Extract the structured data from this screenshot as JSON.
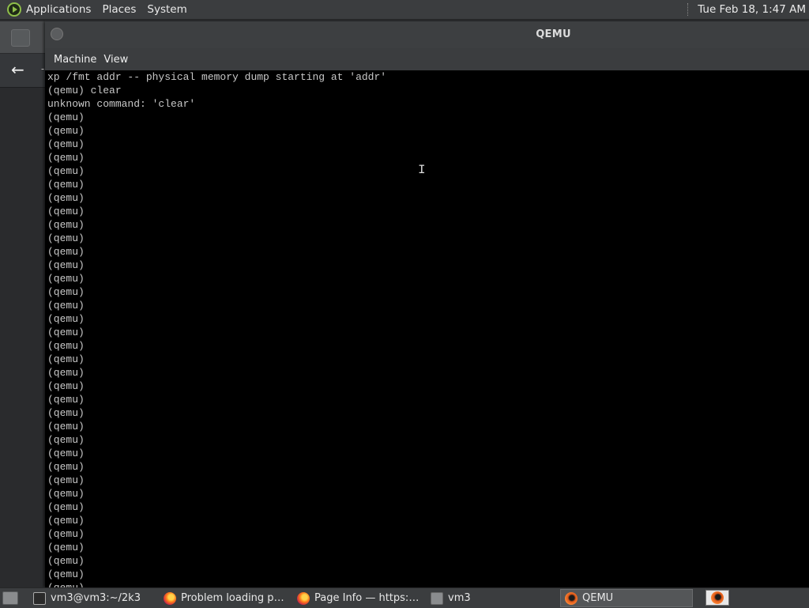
{
  "top_panel": {
    "menus": [
      "Applications",
      "Places",
      "System"
    ],
    "clock": "Tue Feb 18,  1:47 AM",
    "logo_icon": "mate-menu-icon"
  },
  "background_window": {
    "nav_icon": "back-arrow-icon",
    "back_glyph": "←",
    "dash": "-"
  },
  "qemu": {
    "title": "QEMU",
    "menus": [
      "Machine",
      "View"
    ],
    "console_lines": [
      "xp /fmt addr -- physical memory dump starting at 'addr'",
      "(qemu) clear",
      "unknown command: 'clear'",
      "(qemu)",
      "(qemu)",
      "(qemu)",
      "(qemu)",
      "(qemu)",
      "(qemu)",
      "(qemu)",
      "(qemu)",
      "(qemu)",
      "(qemu)",
      "(qemu)",
      "(qemu)",
      "(qemu)",
      "(qemu)",
      "(qemu)",
      "(qemu)",
      "(qemu)",
      "(qemu)",
      "(qemu)",
      "(qemu)",
      "(qemu)",
      "(qemu)",
      "(qemu)",
      "(qemu)",
      "(qemu)",
      "(qemu)",
      "(qemu)",
      "(qemu)",
      "(qemu)",
      "(qemu)",
      "(qemu)",
      "(qemu)",
      "(qemu)",
      "(qemu)",
      "(qemu)",
      "(qemu)",
      "(qemu)"
    ],
    "cursor_glyph": "I"
  },
  "taskbar": {
    "tasks": [
      {
        "label": "vm3@vm3:~/2k3",
        "icon": "terminal-icon",
        "active": false
      },
      {
        "label": "Problem loading pa...",
        "icon": "firefox-icon",
        "active": false
      },
      {
        "label": "Page Info — https:/...",
        "icon": "firefox-icon",
        "active": false
      },
      {
        "label": "vm3",
        "icon": "folder-icon",
        "active": false
      },
      {
        "label": "QEMU",
        "icon": "qemu-icon",
        "active": true
      }
    ],
    "tray_icon": "qemu-icon"
  },
  "colors": {
    "panel": "#3b3d3f",
    "console_bg": "#000000",
    "console_text": "#c8c8c8"
  }
}
